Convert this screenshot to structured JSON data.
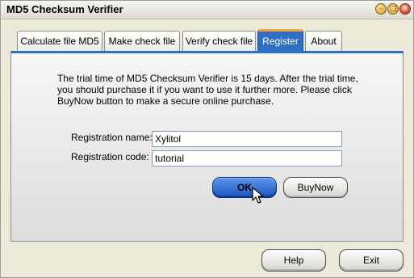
{
  "window": {
    "title": "MD5 Checksum Verifier",
    "minimize_glyph": "–",
    "maximize_glyph": "□",
    "close_glyph": "✕"
  },
  "tabs": [
    {
      "label": "Calculate file MD5",
      "active": false
    },
    {
      "label": "Make check file",
      "active": false
    },
    {
      "label": "Verify check file",
      "active": false
    },
    {
      "label": "Register",
      "active": true
    },
    {
      "label": "About",
      "active": false
    }
  ],
  "register": {
    "info_text": "The trial time of MD5 Checksum Verifier is 15 days. After the trial time, you should purchase it if you want to use it further more. Please click BuyNow button to make a secure online purchase.",
    "name_label": "Registration name:",
    "name_value": "Xylitol",
    "code_label": "Registration code:",
    "code_value": "tutorial",
    "ok_label": "OK",
    "buynow_label": "BuyNow"
  },
  "footer": {
    "help_label": "Help",
    "exit_label": "Exit"
  }
}
